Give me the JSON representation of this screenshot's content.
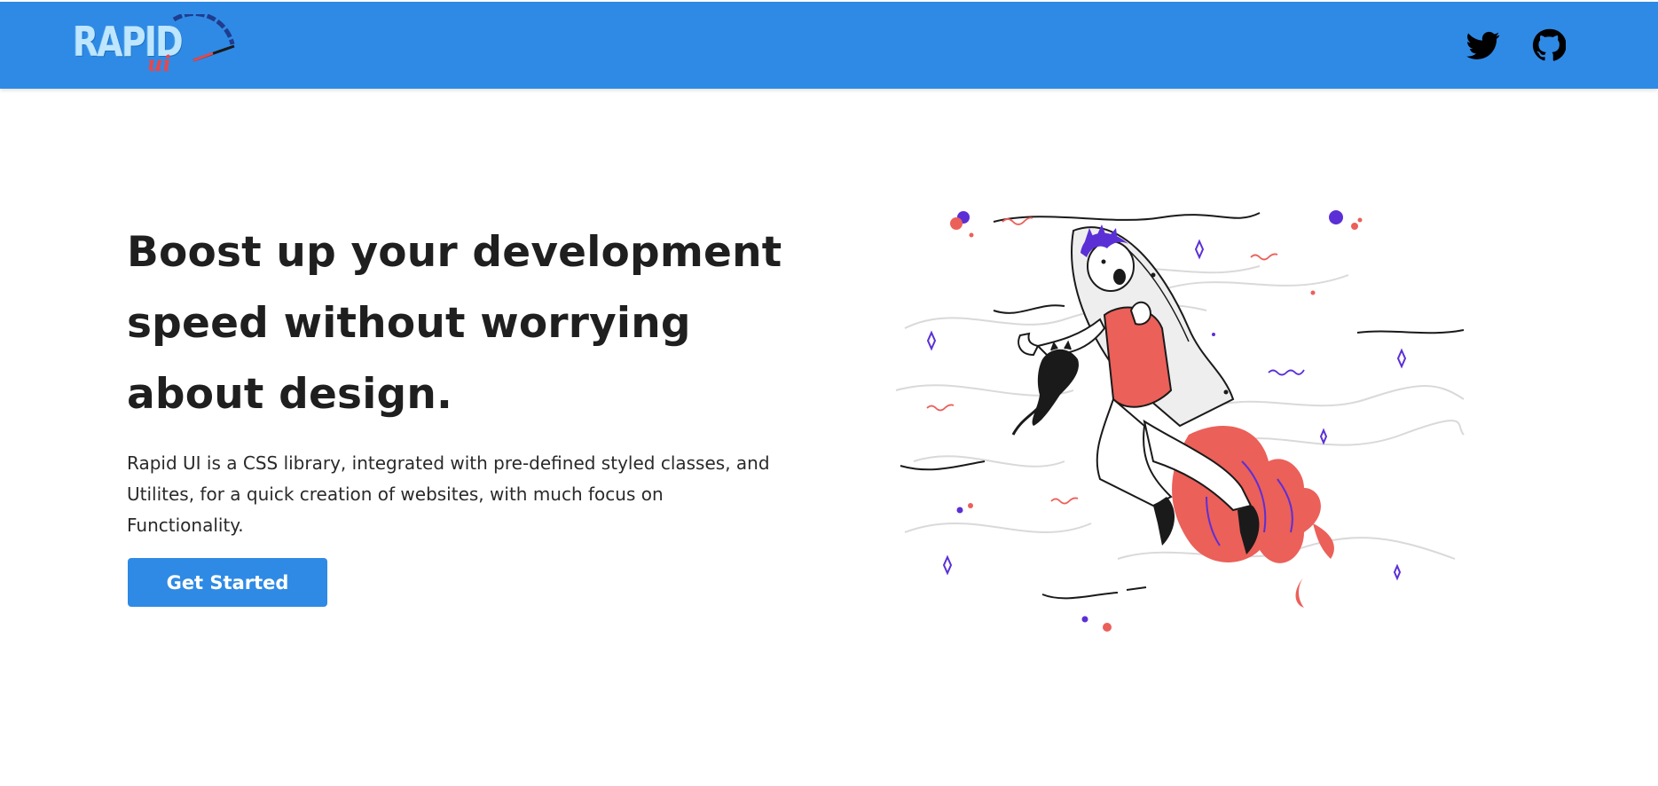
{
  "header": {
    "logo": {
      "text_main": "RAPID",
      "text_sub": "ui",
      "icon": "speedometer-logo-icon"
    },
    "nav_icons": [
      {
        "name": "twitter-icon",
        "label": "Twitter"
      },
      {
        "name": "github-icon",
        "label": "GitHub"
      }
    ]
  },
  "hero": {
    "title": "Boost up your development speed without worrying about design.",
    "description": "Rapid UI is a CSS library, integrated with pre-defined styled classes, and Utilites, for a quick creation of websites, with much focus on Functionality.",
    "cta_label": "Get Started",
    "illustration_icon": "rocket-boy-illustration-icon"
  },
  "colors": {
    "brand_blue": "#2f8ae5",
    "accent_red": "#eb6059",
    "accent_purple": "#5b2fd6",
    "text_dark": "#1f1f1f"
  }
}
